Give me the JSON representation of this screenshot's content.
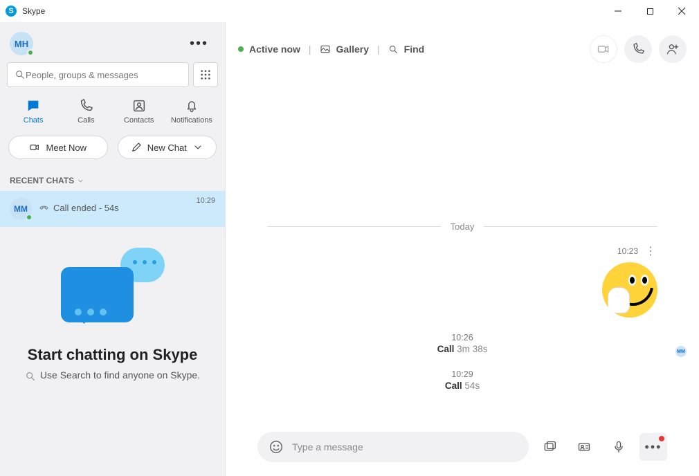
{
  "window": {
    "title": "Skype"
  },
  "profile": {
    "initials": "MH"
  },
  "search": {
    "placeholder": "People, groups & messages"
  },
  "nav": {
    "chats": "Chats",
    "calls": "Calls",
    "contacts": "Contacts",
    "notifications": "Notifications"
  },
  "actions": {
    "meet_now": "Meet Now",
    "new_chat": "New Chat"
  },
  "section": {
    "recent": "RECENT CHATS"
  },
  "chat": {
    "initials": "MM",
    "time": "10:29",
    "preview": "Call ended - 54s"
  },
  "promo": {
    "title": "Start chatting on Skype",
    "subtitle": "Use Search to find anyone on Skype."
  },
  "header": {
    "active": "Active now",
    "gallery": "Gallery",
    "find": "Find"
  },
  "conversation": {
    "day": "Today",
    "msg_time": "10:23",
    "call1": {
      "time": "10:26",
      "label": "Call",
      "duration": "3m 38s"
    },
    "call2": {
      "time": "10:29",
      "label": "Call",
      "duration": "54s"
    },
    "receipt_initials": "MM"
  },
  "composer": {
    "placeholder": "Type a message"
  }
}
